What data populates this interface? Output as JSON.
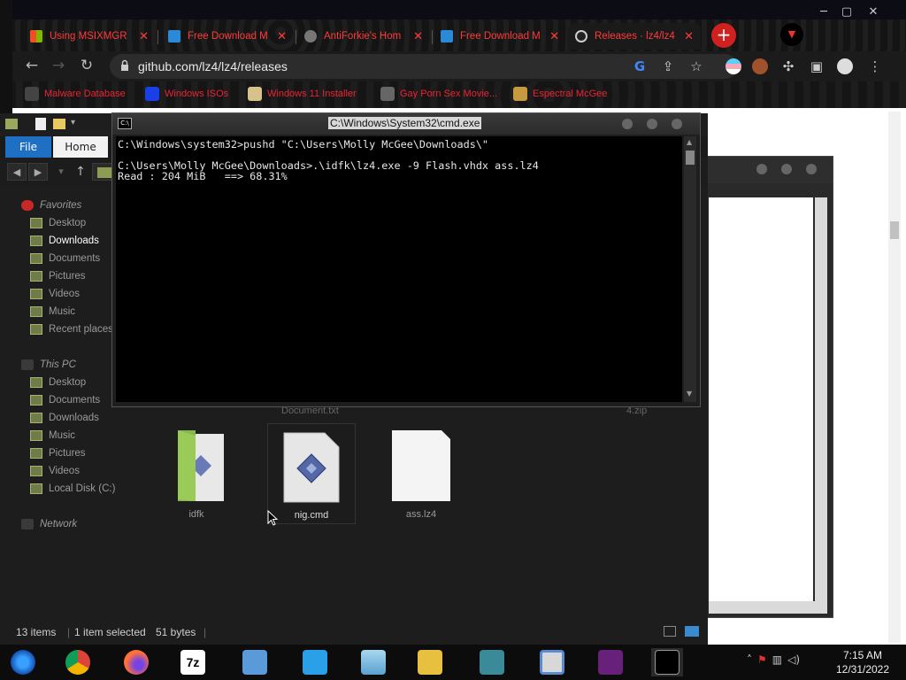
{
  "browser": {
    "tabs": [
      {
        "title": "Using MSIXMGR",
        "favicon": "microsoft-icon",
        "active": false
      },
      {
        "title": "Free Download M",
        "favicon": "download-icon",
        "active": false
      },
      {
        "title": "AntiForkie's Hom",
        "favicon": "globe-icon",
        "active": false
      },
      {
        "title": "Free Download M",
        "favicon": "download-icon",
        "active": false
      },
      {
        "title": "Releases · lz4/lz4",
        "favicon": "github-icon",
        "active": true
      }
    ],
    "close_glyph": "✕",
    "new_tab_glyph": "+",
    "url": "github.com/lz4/lz4/releases",
    "bookmarks": [
      {
        "label": "Malware Database",
        "icon": "skull-icon"
      },
      {
        "label": "Windows ISOs",
        "icon": "x-icon"
      },
      {
        "label": "Windows 11 Installer",
        "icon": "folder-icon"
      },
      {
        "label": "Gay Porn Sex Movie...",
        "icon": "bookmark-icon"
      },
      {
        "label": "Espectral McGee",
        "icon": "bookmark-icon"
      }
    ],
    "accent_color": "#ff3b3b"
  },
  "explorer": {
    "ribbon": {
      "file_label": "File",
      "home_label": "Home"
    },
    "nav": [
      {
        "label": "Favorites",
        "type": "header"
      },
      {
        "label": "Desktop"
      },
      {
        "label": "Downloads",
        "selected": true
      },
      {
        "label": "Documents"
      },
      {
        "label": "Pictures"
      },
      {
        "label": "Videos"
      },
      {
        "label": "Music"
      },
      {
        "label": "Recent places"
      },
      {
        "label": "This PC",
        "type": "header"
      },
      {
        "label": "Desktop"
      },
      {
        "label": "Documents"
      },
      {
        "label": "Downloads"
      },
      {
        "label": "Music"
      },
      {
        "label": "Pictures"
      },
      {
        "label": "Videos"
      },
      {
        "label": "Local Disk (C:)"
      },
      {
        "label": "Network",
        "type": "header"
      }
    ],
    "partial_labels": [
      "Document.txt",
      "4.zip"
    ],
    "files": [
      {
        "name": "idfk",
        "kind": "folder"
      },
      {
        "name": "nig.cmd",
        "kind": "cmd-script",
        "selected": true
      },
      {
        "name": "ass.lz4",
        "kind": "blank-file"
      }
    ],
    "status": {
      "items": "13 items",
      "selected": "1 item selected",
      "size": "51 bytes"
    }
  },
  "cmd": {
    "title": "C:\\Windows\\System32\\cmd.exe",
    "lines": [
      "C:\\Windows\\system32>pushd \"C:\\Users\\Molly McGee\\Downloads\\\"",
      "",
      "C:\\Users\\Molly McGee\\Downloads>.\\idfk\\lz4.exe -9 Flash.vhdx ass.lz4",
      "Read : 204 MiB   ==> 68.31%"
    ]
  },
  "taskbar": {
    "apps": [
      "windows-start-icon",
      "chrome-icon",
      "firefox-icon",
      "7zip-icon",
      "network-users-icon",
      "remote-desktop-icon",
      "notepad-icon",
      "file-explorer-icon",
      "package-icon",
      "monitor-icon",
      "visual-studio-icon",
      "cmd-icon"
    ],
    "time": "7:15 AM",
    "date": "12/31/2022"
  }
}
